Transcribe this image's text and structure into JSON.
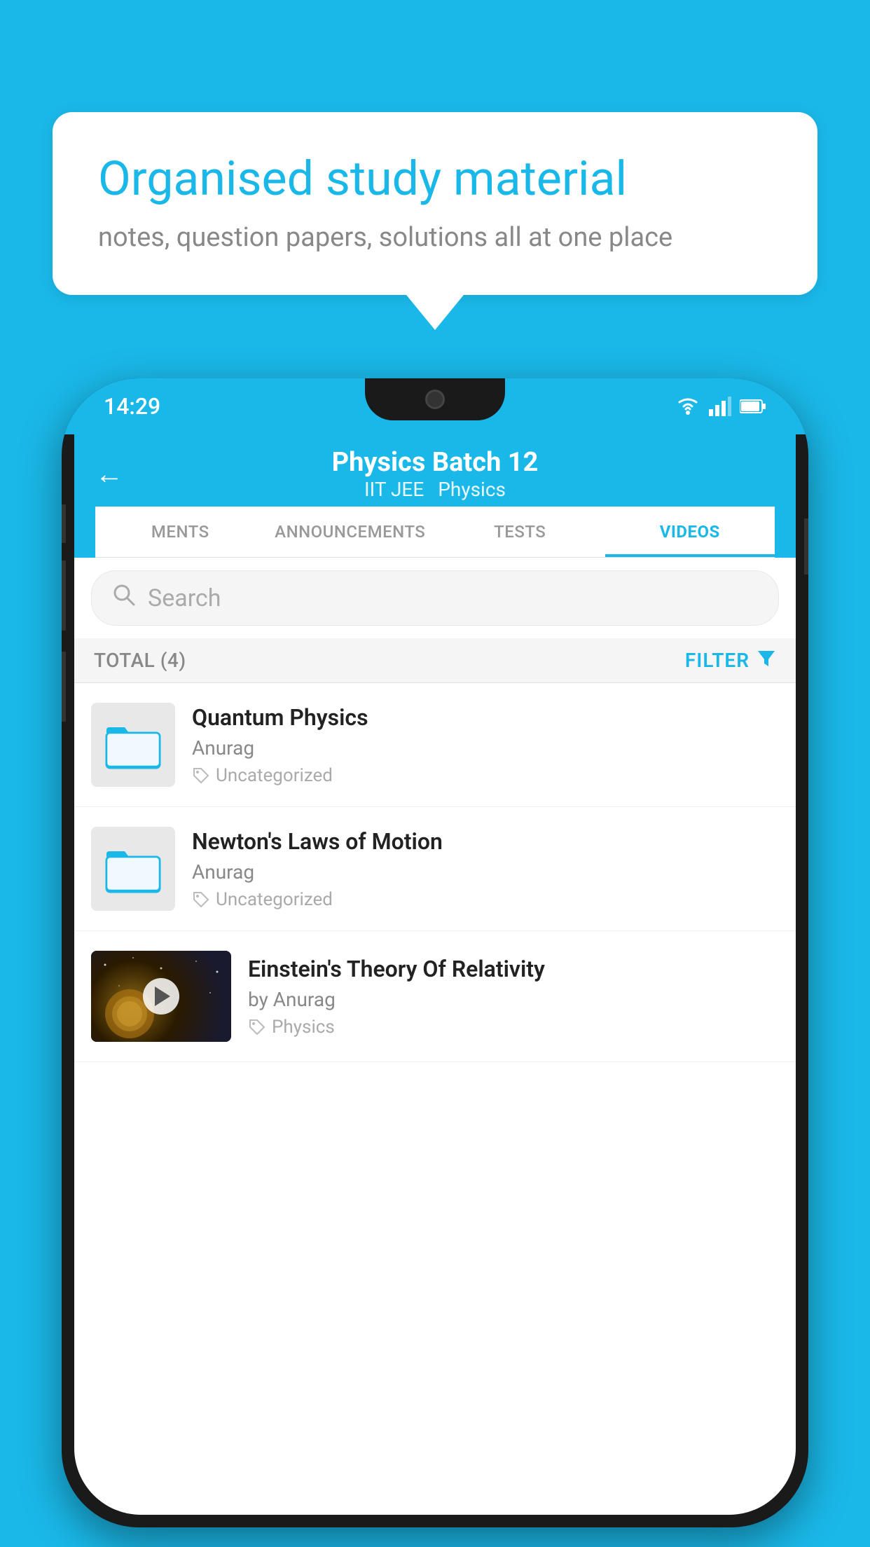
{
  "background_color": "#1ab8e8",
  "speech_bubble": {
    "title": "Organised study material",
    "subtitle": "notes, question papers, solutions all at one place"
  },
  "phone": {
    "status_bar": {
      "time": "14:29"
    },
    "header": {
      "title": "Physics Batch 12",
      "subtitle_parts": [
        "IIT JEE",
        "Physics"
      ],
      "back_label": "←"
    },
    "tabs": [
      {
        "label": "MENTS",
        "active": false
      },
      {
        "label": "ANNOUNCEMENTS",
        "active": false
      },
      {
        "label": "TESTS",
        "active": false
      },
      {
        "label": "VIDEOS",
        "active": true
      }
    ],
    "search": {
      "placeholder": "Search"
    },
    "filter_row": {
      "total_label": "TOTAL (4)",
      "filter_label": "FILTER"
    },
    "video_items": [
      {
        "id": 1,
        "title": "Quantum Physics",
        "author": "Anurag",
        "tag": "Uncategorized",
        "has_thumbnail": false
      },
      {
        "id": 2,
        "title": "Newton's Laws of Motion",
        "author": "Anurag",
        "tag": "Uncategorized",
        "has_thumbnail": false
      },
      {
        "id": 3,
        "title": "Einstein's Theory Of Relativity",
        "author": "by Anurag",
        "tag": "Physics",
        "has_thumbnail": true
      }
    ]
  }
}
